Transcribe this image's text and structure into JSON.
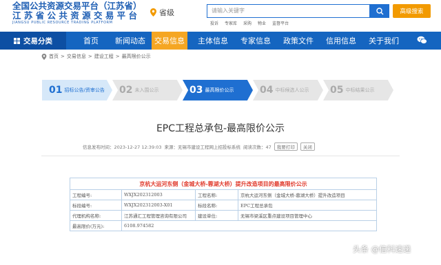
{
  "header": {
    "logo_line1": "全国公共资源交易平台（江苏省）",
    "logo_line2": "江 苏 省 公 共 资 源 交 易 平 台",
    "logo_line3": "JIANGSU PUBLIC RESOURCE TRADING PLATFORM",
    "region": "省级",
    "search_placeholder": "请输入关键字",
    "advanced_search": "高级搜索",
    "quick_links": [
      "投诉",
      "专家库",
      "采购",
      "物业",
      "监督平台"
    ]
  },
  "nav": {
    "category": "交易分类",
    "items": [
      "首页",
      "新闻动态",
      "交易信息",
      "主体信息",
      "专家信息",
      "政策文件",
      "信用信息",
      "关于我们"
    ],
    "active_index": 2
  },
  "breadcrumb": [
    "首页",
    "交易信息",
    "建设工程",
    "最高限价公示"
  ],
  "steps": [
    {
      "num": "01",
      "label": "招标公告/资审公告",
      "state": "done"
    },
    {
      "num": "02",
      "label": "未入围公示",
      "state": "pending"
    },
    {
      "num": "03",
      "label": "最高限价公示",
      "state": "active"
    },
    {
      "num": "04",
      "label": "中标候选人公示",
      "state": "pending"
    },
    {
      "num": "05",
      "label": "中标结果公示",
      "state": "pending"
    }
  ],
  "article": {
    "title": "EPC工程总承包-最高限价公示",
    "publish_time": "信息发布时间：2023-12-27 12:39:03",
    "source": "来源：无锡市建设工程网上招投标系统",
    "views": "阅读次数：47",
    "btn_print": "我要打印",
    "btn_close": "关闭"
  },
  "table": {
    "heading": "京杭大运河东侧（金城大桥-蓉湖大桥）提升改造项目的最高限价公示",
    "rows": [
      [
        "工程编号:",
        "WXJX202312003",
        "工程名称:",
        "京杭大运河东侧（金城大桥-蓉湖大桥）提升改造项目"
      ],
      [
        "标段编号:",
        "WXJX202312003-X01",
        "标段名称:",
        "EPC工程总承包"
      ],
      [
        "代理机构名称:",
        "江苏通汇工程管理咨询有限公司",
        "建设单位:",
        "无锡市梁溪区重点建设项目管理中心"
      ],
      [
        "最高限价(万元):",
        "6108.974582",
        "",
        ""
      ]
    ]
  },
  "watermark": "头条 @信科速递"
}
